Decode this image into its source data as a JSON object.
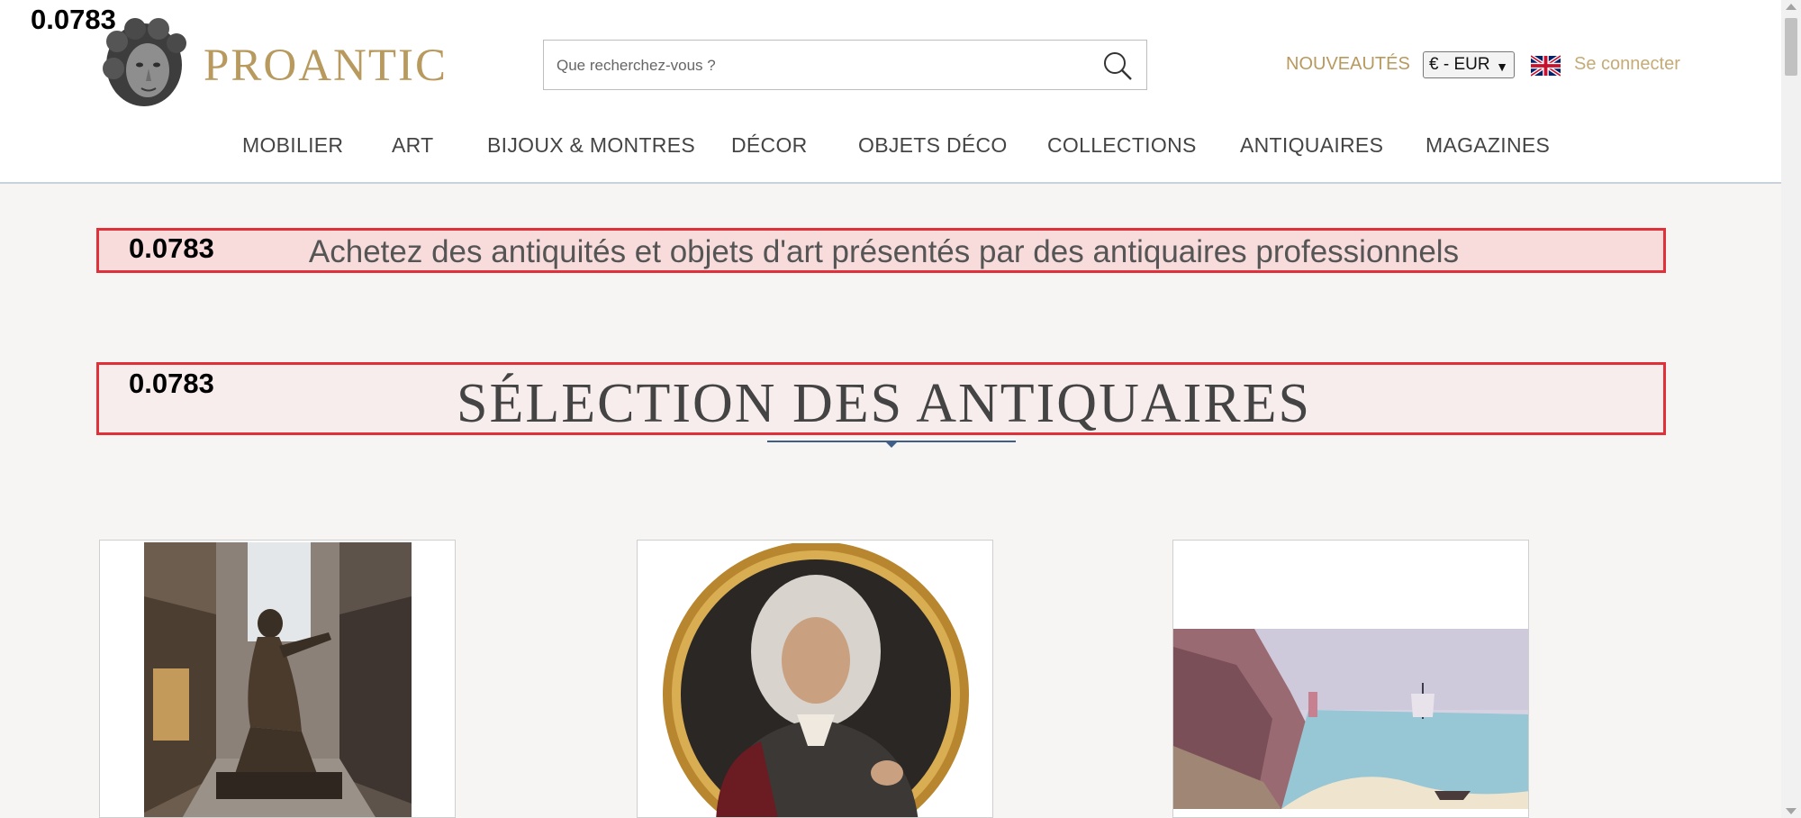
{
  "overlay_score": "0.0783",
  "header": {
    "brand": "PROANTIC",
    "search": {
      "placeholder": "Que recherchez-vous ?"
    },
    "nouveautes": "NOUVEAUTÉS",
    "currency": "€ - EUR",
    "login": "Se connecter",
    "icons": {
      "search": "search-icon",
      "flag": "uk-flag-icon",
      "logo": "statue-head-logo"
    }
  },
  "nav": [
    "MOBILIER",
    "ART",
    "BIJOUX & MONTRES",
    "DÉCOR",
    "OBJETS DÉCO",
    "COLLECTIONS",
    "ANTIQUAIRES",
    "MAGAZINES"
  ],
  "banner": {
    "score": "0.0783",
    "text": "Achetez des antiquités et objets d'art présentés par des antiquaires professionnels"
  },
  "section": {
    "score": "0.0783",
    "title": "SÉLECTION DES ANTIQUAIRES"
  },
  "cards": [
    {
      "image": "bronze-sculpture-street-photo"
    },
    {
      "image": "oval-portrait-painting"
    },
    {
      "image": "coastal-seascape-painting"
    }
  ],
  "colors": {
    "brand_gold": "#b8995e",
    "highlight_border": "#e0303a",
    "divider_blue": "#3f5f88"
  }
}
